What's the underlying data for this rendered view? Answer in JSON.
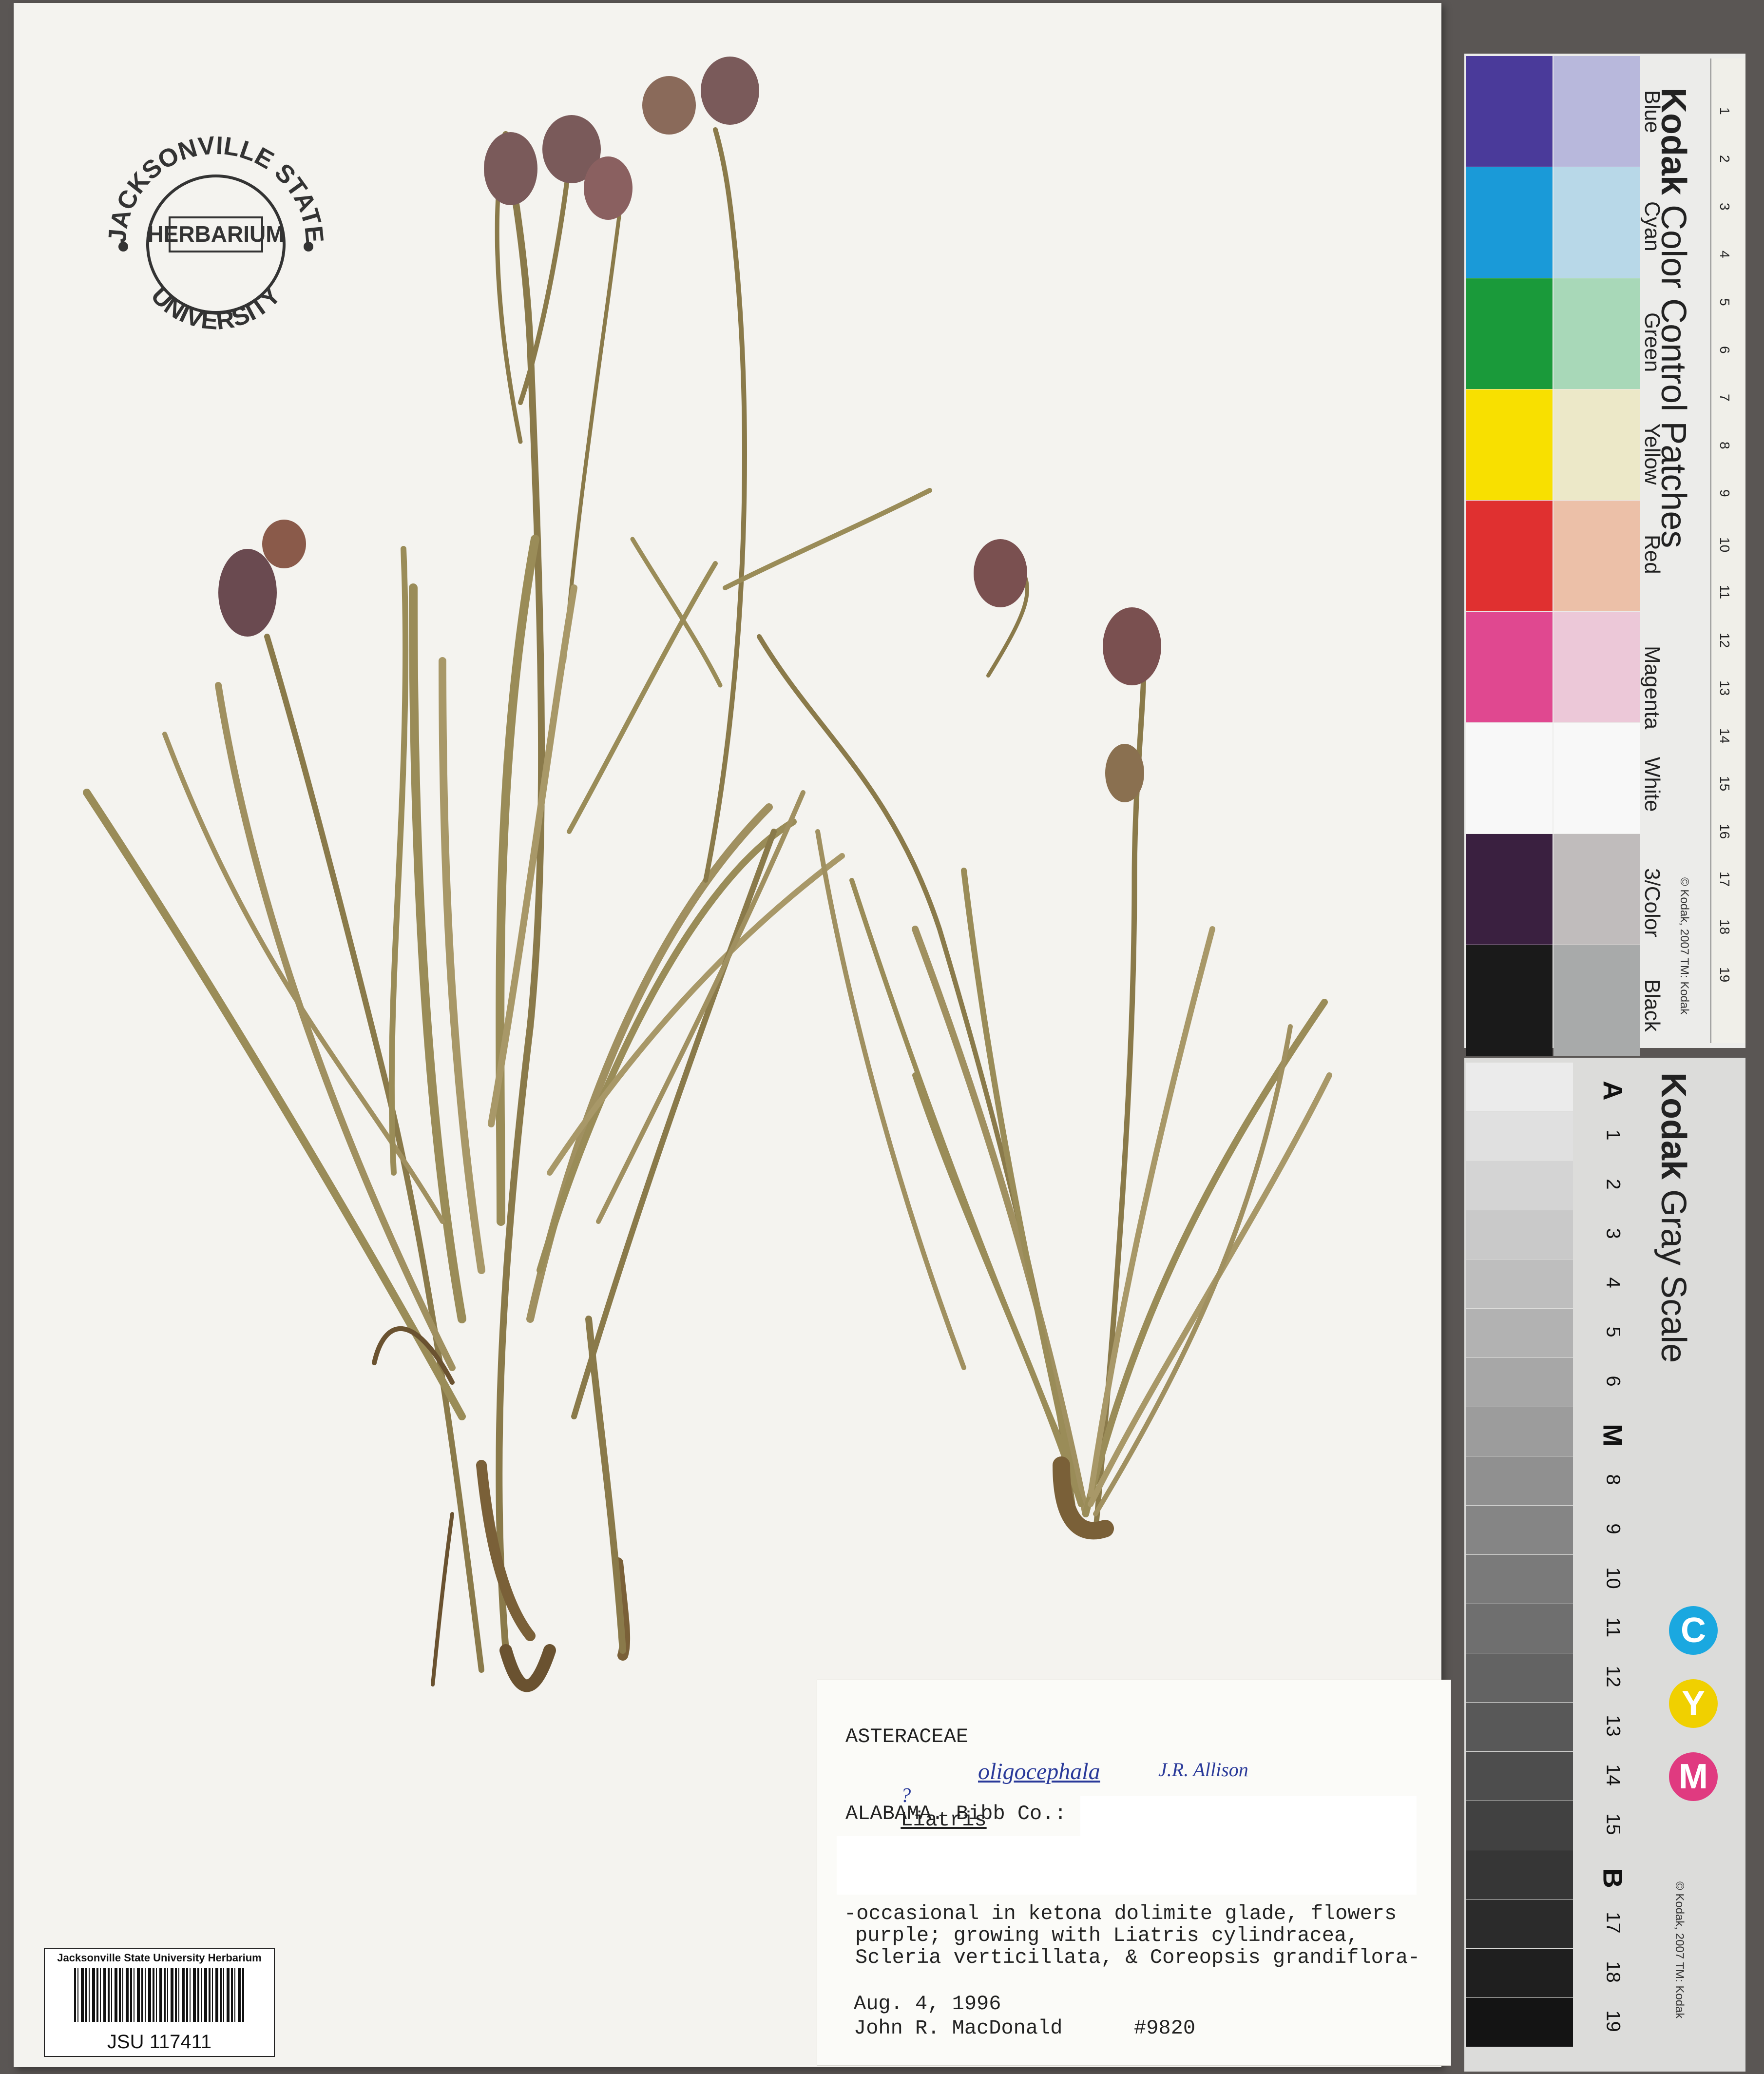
{
  "stamp": {
    "top_text": "JACKSONVILLE STATE",
    "center_text": "HERBARIUM",
    "bottom_text": "UNIVERSITY"
  },
  "label": {
    "family": "ASTERACEAE",
    "genus_prefix": "?",
    "genus": "Liatris",
    "epithet_hand": "oligocephala",
    "determiner_hand": "J.R. Allison",
    "locality": "ALABAMA. Bibb Co.:",
    "habitat_line1": "-occasional in ketona dolimite glade, flowers",
    "habitat_line2": "purple; growing with Liatris cylindracea,",
    "habitat_line3": "Scleria verticillata, & Coreopsis grandiflora-",
    "date": "Aug. 4, 1996",
    "collector": "John R. MacDonald",
    "number": "#9820"
  },
  "barcode": {
    "institution": "Jacksonville State University Herbarium",
    "catalog": "JSU 117411"
  },
  "color_card": {
    "title_bold": "Kodak",
    "title_rest": "Color Control Patches",
    "copyright": "© Kodak, 2007 TM: Kodak",
    "ruler_units": [
      "inches",
      "cm"
    ],
    "ruler_numbers": [
      "1",
      "2",
      "3",
      "4",
      "5",
      "6",
      "7",
      "8",
      "9",
      "10",
      "11",
      "12",
      "13",
      "14",
      "15",
      "16",
      "17",
      "18",
      "19"
    ],
    "patches": [
      {
        "label": "Blue",
        "dark": "#4a3a9a",
        "light": "#b8b8dc"
      },
      {
        "label": "Cyan",
        "dark": "#1a9ad8",
        "light": "#b8d8e8"
      },
      {
        "label": "Green",
        "dark": "#1a9a3a",
        "light": "#a8d8b8"
      },
      {
        "label": "Yellow",
        "dark": "#f8e000",
        "light": "#ece8c8"
      },
      {
        "label": "Red",
        "dark": "#e03030",
        "light": "#ecc0a8"
      },
      {
        "label": "Magenta",
        "dark": "#e04890",
        "light": "#ecc8d8"
      },
      {
        "label": "White",
        "dark": "#f8f8f8",
        "light": "#f8f8f8"
      },
      {
        "label": "3/Color",
        "dark": "#3a2040",
        "light": "#c0bcbc"
      },
      {
        "label": "Black",
        "dark": "#1a1a1a",
        "light": "#a8aaaa"
      }
    ]
  },
  "gray_card": {
    "title_bold": "Kodak",
    "title_rest": "Gray Scale",
    "copyright": "© Kodak, 2007 TM: Kodak",
    "steps": [
      "A",
      "1",
      "2",
      "3",
      "4",
      "5",
      "6",
      "M",
      "8",
      "9",
      "10",
      "11",
      "12",
      "13",
      "14",
      "15",
      "B",
      "17",
      "18",
      "19"
    ],
    "cym": [
      {
        "letter": "C",
        "color": "#1aa8e0"
      },
      {
        "letter": "Y",
        "color": "#f0d000"
      },
      {
        "letter": "M",
        "color": "#e03a80"
      }
    ]
  }
}
